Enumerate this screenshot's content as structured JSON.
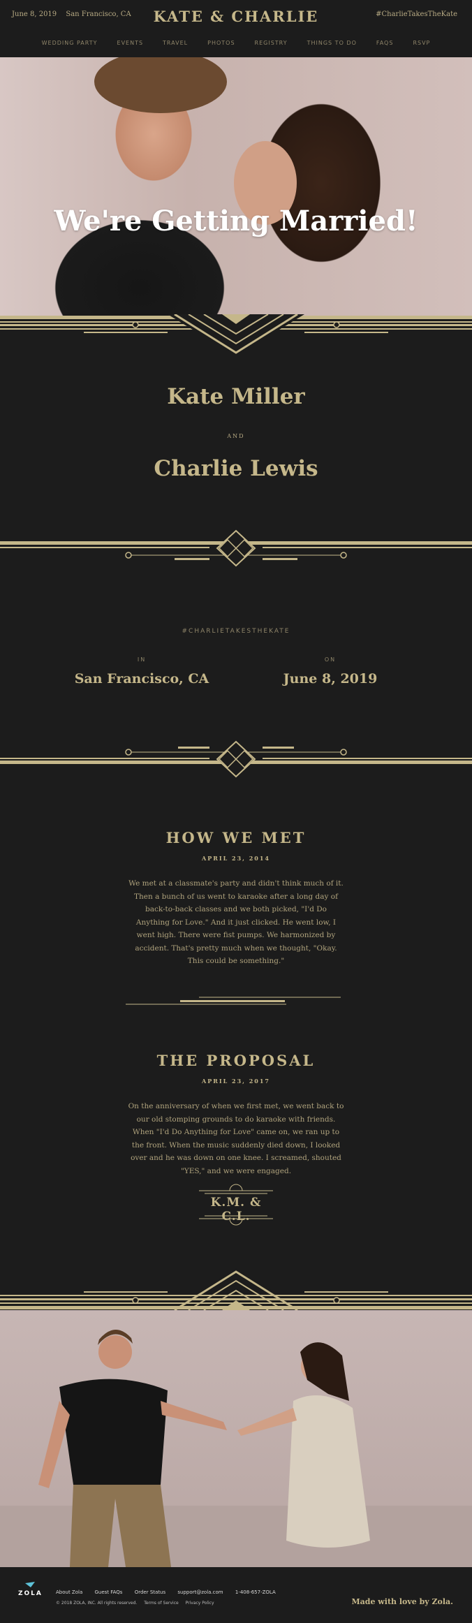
{
  "header": {
    "date": "June 8, 2019",
    "location": "San Francisco, CA",
    "title": "KATE & CHARLIE",
    "hashtag": "#CharlieTakesTheKate"
  },
  "nav": [
    "WEDDING PARTY",
    "EVENTS",
    "TRAVEL",
    "PHOTOS",
    "REGISTRY",
    "THINGS TO DO",
    "FAQS",
    "RSVP"
  ],
  "hero": {
    "title": "We're Getting Married!"
  },
  "couple": {
    "name1": "Kate Miller",
    "and": "AND",
    "name2": "Charlie Lewis"
  },
  "details": {
    "hashtag": "#CHARLIETAKESTHEKATE",
    "in_label": "IN",
    "in_value": "San Francisco, CA",
    "on_label": "ON",
    "on_value": "June 8, 2019"
  },
  "how_we_met": {
    "title": "HOW WE MET",
    "date": "APRIL 23, 2014",
    "text": "We met at a classmate's party and didn't think much of it. Then a bunch of us went to karaoke after a long day of back-to-back classes and we both picked, \"I'd Do Anything for Love.\" And it just clicked. He went low, I went high. There were fist pumps. We harmonized by accident. That's pretty much when we thought, \"Okay. This could be something.\""
  },
  "proposal": {
    "title": "THE PROPOSAL",
    "date": "APRIL 23, 2017",
    "text": "On the anniversary of when we first met, we went back to our old stomping grounds to do karaoke with friends. When \"I'd Do Anything for Love\" came on, we ran up to the front. When the music suddenly died down, I looked over and he was down on one knee. I screamed, shouted \"YES,\" and we were engaged."
  },
  "monogram": "K.M. & C.L.",
  "footer": {
    "brand": "ZOLA",
    "links": [
      "About Zola",
      "Guest FAQs",
      "Order Status",
      "support@zola.com",
      "1-408-657-ZOLA"
    ],
    "copyright": "© 2018 ZOLA, INC.  All rights reserved.",
    "terms": "Terms of Service",
    "privacy": "Privacy Policy",
    "made_with": "Made with love by Zola."
  },
  "colors": {
    "background": "#1c1c1c",
    "gold": "#c5b78a",
    "text": "#b0a37d"
  }
}
